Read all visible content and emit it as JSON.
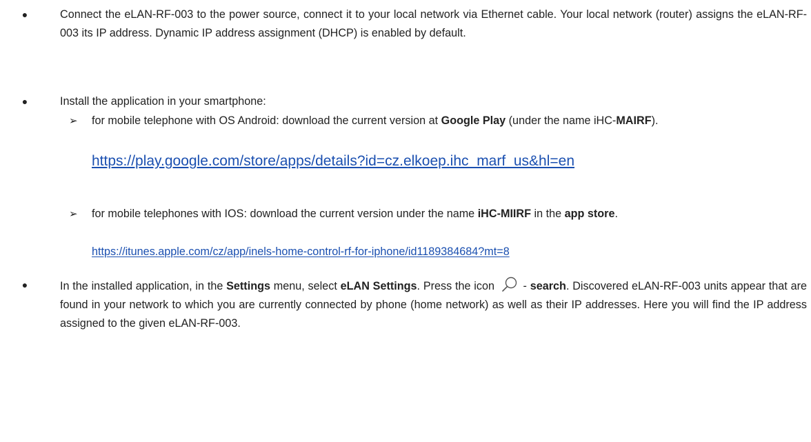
{
  "bullets": [
    {
      "text": "Connect the eLAN-RF-003 to the power source, connect it to your local network via Ethernet cable. Your local network (router) assigns the eLAN-RF-003 its IP address. Dynamic IP address assignment (DHCP) is enabled by default."
    },
    {
      "text": "Install the application in your smartphone:",
      "sub": [
        {
          "pre": "for mobile telephone with OS Android: download the current version at ",
          "bold1": "Google Play",
          "mid": " (under the name iHC-",
          "bold2": "MAIRF",
          "post": ").",
          "link": "https://play.google.com/store/apps/details?id=cz.elkoep.ihc_marf_us&hl=en"
        },
        {
          "pre": "for mobile telephones with IOS: download the current version under the name ",
          "bold1": "iHC-MIIRF",
          "mid": " in the ",
          "bold2": "app store",
          "post": ".",
          "link": "https://itunes.apple.com/cz/app/inels-home-control-rf-for-iphone/id1189384684?mt=8"
        }
      ]
    },
    {
      "pre": "In the installed application, in the ",
      "bold1": "Settings",
      "mid1": " menu, select ",
      "bold2": "eLAN Settings",
      "mid2": ". Press the icon ",
      "icon": "search-icon",
      "mid3": " - ",
      "bold3": "search",
      "post": ". Discovered eLAN-RF-003 units appear that are found in your network to which you are currently connected by phone (home network) as well as their IP addresses. Here you will find the IP address assigned to the given eLAN-RF-003."
    }
  ]
}
